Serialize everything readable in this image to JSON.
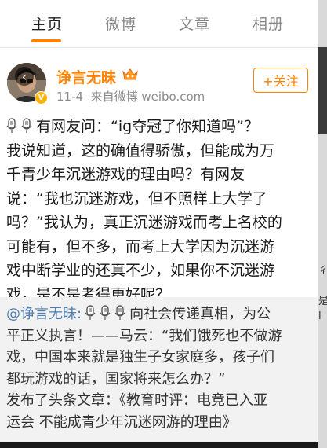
{
  "tabs": [
    {
      "label": "主页",
      "active": true
    },
    {
      "label": "微博",
      "active": false
    },
    {
      "label": "文章",
      "active": false
    },
    {
      "label": "相册",
      "active": false
    }
  ],
  "accent_color": "#ff8200",
  "link_color": "#507daf",
  "post": {
    "author": "诤言无昧",
    "date": "11-4",
    "source": "来自微博 weibo.com",
    "follow_label": "+关注",
    "lines": [
      "有网友问：“ig夺冠了你知道吗”？",
      "我说知道，这的确值得骄傲，但能成为万",
      "千青少年沉迷游戏的理由吗？有网友",
      "说：“我也沉迷游戏，但不照样上大学了",
      "吗？”我认为，真正沉迷游戏而考上名校的",
      "可能有，但不多，而考上大学因为沉迷游",
      "戏中断学业的还真不少，如果你不沉迷游",
      "戏，是不是考得更好呢？"
    ]
  },
  "repost": {
    "mention": "@诤言无昧:",
    "lines": [
      "向社会传递真相，为公",
      "平正义执言！——马云：“我们饿死也不做游",
      "戏，中国本来就是独生子女家庭多，孩子们",
      "都玩游戏的话，国家将来怎么办？”",
      "发布了头条文章：《教育时评：电竞已入亚",
      "运会 不能成青少年沉迷网游的理由》"
    ]
  },
  "side_strip": {
    "glyphs": [
      "彳",
      "是",
      "l"
    ]
  }
}
